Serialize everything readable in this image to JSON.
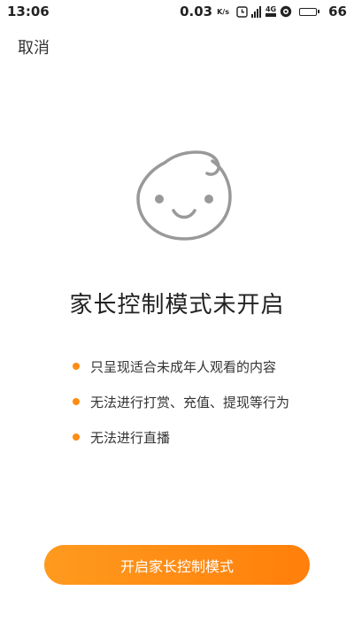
{
  "status_bar": {
    "time": "13:06",
    "net_speed": "0.03",
    "net_unit": "K/s",
    "network_label": "4G",
    "battery_level": "66",
    "battery_fraction": 0.66
  },
  "header": {
    "cancel_label": "取消"
  },
  "illustration": {
    "icon": "baby-face-icon"
  },
  "main": {
    "title": "家长控制模式未开启",
    "features": [
      "只呈现适合未成年人观看的内容",
      "无法进行打赏、充值、提现等行为",
      "无法进行直播"
    ]
  },
  "action": {
    "button_label": "开启家长控制模式"
  },
  "colors": {
    "accent": "#FF8C14",
    "accent_gradient_start": "#FF9A1F",
    "accent_gradient_end": "#FF7F0A",
    "illustration_stroke": "#999999"
  }
}
